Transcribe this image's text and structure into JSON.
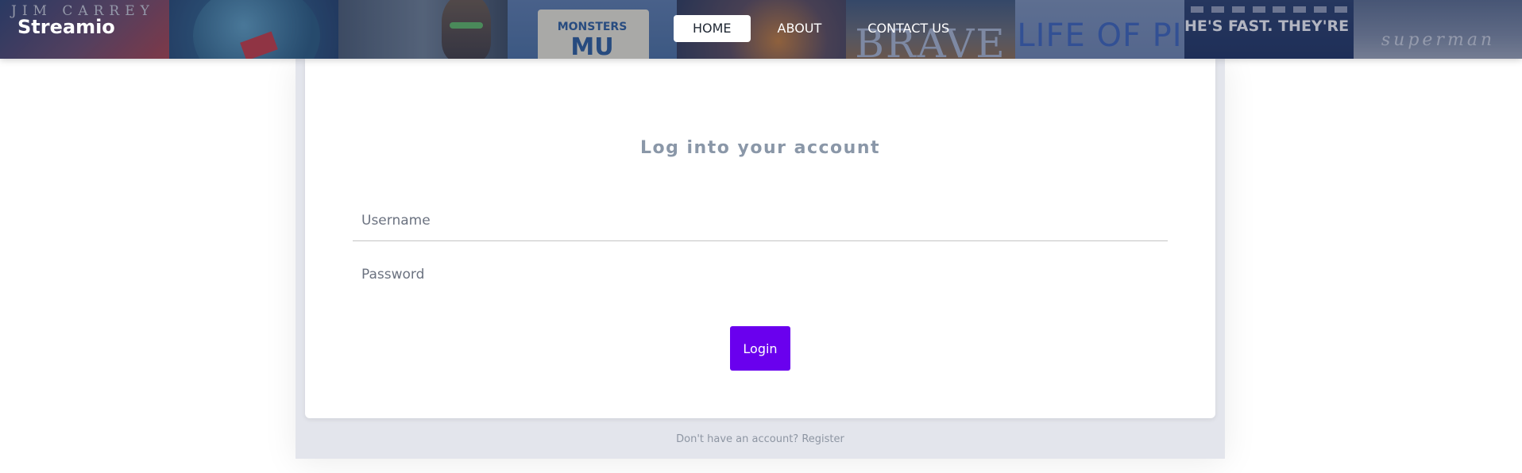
{
  "brand": {
    "name": "Streamio"
  },
  "nav": {
    "items": [
      {
        "label": "HOME",
        "active": true
      },
      {
        "label": "ABOUT",
        "active": false
      },
      {
        "label": "CONTACT US",
        "active": false
      }
    ]
  },
  "posters": {
    "p1_text": "JIM CARREY",
    "p4_top": "MONSTERS",
    "p4_mu": "MU",
    "p6_text": "BRAVE",
    "p7_text": "LIFE OF PI",
    "p8_text": "HE'S FAST. THEY'RE FURIOUS.",
    "p9_text": "superman"
  },
  "login": {
    "title": "Log into your account",
    "username_placeholder": "Username",
    "password_placeholder": "Password",
    "button_label": "Login"
  },
  "footer": {
    "prompt": "Don't have an account?",
    "register_label": "Register"
  },
  "colors": {
    "accent": "#6a00ee",
    "title_text": "#8a97a8",
    "card_backdrop": "#e3e5ec"
  }
}
